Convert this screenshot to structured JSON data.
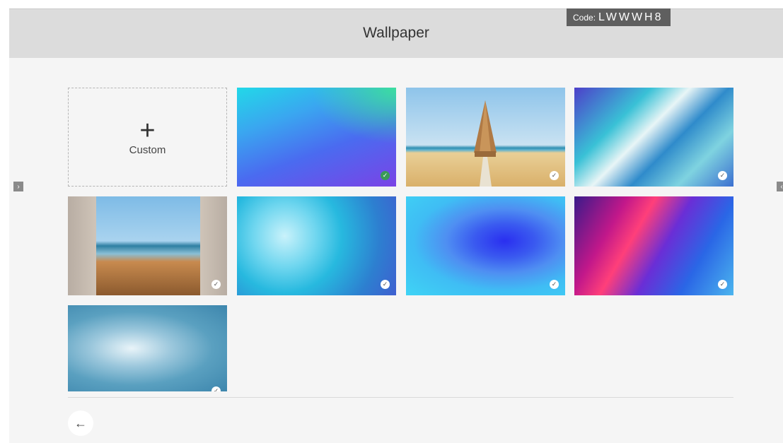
{
  "header": {
    "title": "Wallpaper"
  },
  "code_badge": {
    "label": "Code:",
    "value": "LWWWH8"
  },
  "custom_tile": {
    "icon": "+",
    "label": "Custom"
  },
  "wallpapers": [
    {
      "name": "Gradient teal-purple",
      "selected": true
    },
    {
      "name": "Beach pavilion",
      "selected": false
    },
    {
      "name": "Blue fluid marble",
      "selected": false
    },
    {
      "name": "Terrace sea view",
      "selected": false
    },
    {
      "name": "Blue cloud smoke",
      "selected": false
    },
    {
      "name": "Blue swirl",
      "selected": false
    },
    {
      "name": "Pink purple fluid",
      "selected": false
    },
    {
      "name": "Pale blue smoke",
      "selected": false
    }
  ],
  "icons": {
    "check": "✓",
    "back": "←",
    "left_arrow": "›",
    "right_arrow": "‹"
  },
  "colors": {
    "selected_check": "#3a9a57",
    "header_bg": "#dcdcdc",
    "page_bg": "#f5f5f5"
  }
}
